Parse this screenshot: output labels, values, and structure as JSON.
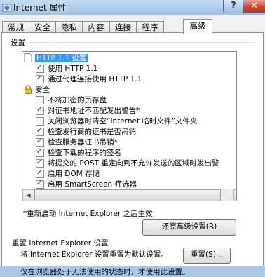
{
  "window": {
    "title": "Internet 属性",
    "help_label": "?",
    "close_label": "✕"
  },
  "tabs": [
    {
      "label": "常规"
    },
    {
      "label": "安全"
    },
    {
      "label": "隐私"
    },
    {
      "label": "内容"
    },
    {
      "label": "连接"
    },
    {
      "label": "程序"
    },
    {
      "label": "高级"
    }
  ],
  "active_tab": "高级",
  "settings": {
    "heading": "设置",
    "items": [
      {
        "label": "HTTP 1.1 设置",
        "kind": "category",
        "icon": "page-icon",
        "selected": true
      },
      {
        "label": "使用 HTTP 1.1",
        "kind": "checkbox",
        "checked": true
      },
      {
        "label": "通过代理连接使用 HTTP 1.1",
        "kind": "checkbox",
        "checked": true
      },
      {
        "label": "安全",
        "kind": "category",
        "icon": "lock-icon"
      },
      {
        "label": "不将加密的页存盘",
        "kind": "checkbox",
        "checked": false
      },
      {
        "label": "对证书地址不匹配发出警告*",
        "kind": "checkbox",
        "checked": true
      },
      {
        "label": "关闭浏览器时清空“Internet 临时文件”文件夹",
        "kind": "checkbox",
        "checked": false
      },
      {
        "label": "检查发行商的证书是否吊销",
        "kind": "checkbox",
        "checked": true
      },
      {
        "label": "检查服务器证书吊销*",
        "kind": "checkbox",
        "checked": true
      },
      {
        "label": "检查下载的程序的签名",
        "kind": "checkbox",
        "checked": true
      },
      {
        "label": "将提交的 POST 重定向到不允许发送的区域时发出警",
        "kind": "checkbox",
        "checked": true
      },
      {
        "label": "启用 DOM 存储",
        "kind": "checkbox",
        "checked": true
      },
      {
        "label": "启用 SmartScreen 筛选器",
        "kind": "checkbox",
        "checked": true
      }
    ],
    "restart_note": "*重新启动 Internet Explorer 之后生效",
    "restore_button": "还原高级设置(R)"
  },
  "reset": {
    "heading": "重置 Internet Explorer 设置",
    "description": "将 Internet Explorer 设置重置为默认设置。",
    "button": "重置(S)...",
    "note": "仅在浏览器处于无法使用的状态时，才使用此设置。"
  }
}
